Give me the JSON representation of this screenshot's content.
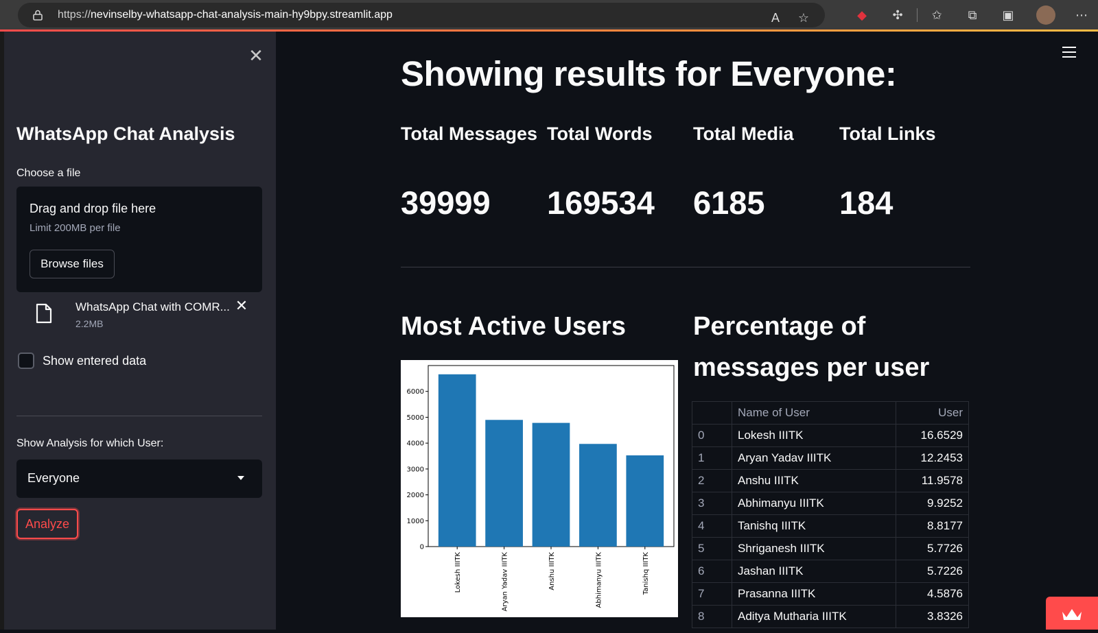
{
  "browser": {
    "url_prefix": "https://",
    "url_domain": "nevinselby-whatsapp-chat-analysis-main-hy9bpy.streamlit.app"
  },
  "sidebar": {
    "title": "WhatsApp Chat Analysis",
    "file_label": "Choose a file",
    "uploader": {
      "drag_text": "Drag and drop file here",
      "limit_text": "Limit 200MB per file",
      "browse_label": "Browse files"
    },
    "file": {
      "name": "WhatsApp Chat with COMR...",
      "size": "2.2MB"
    },
    "checkbox_label": "Show entered data",
    "user_label": "Show Analysis for which User:",
    "user_selected": "Everyone",
    "analyze_label": "Analyze"
  },
  "main": {
    "title": "Showing results for Everyone:",
    "stats": [
      {
        "label": "Total Messages",
        "value": "39999"
      },
      {
        "label": "Total Words",
        "value": "169534"
      },
      {
        "label": "Total Media",
        "value": "6185"
      },
      {
        "label": "Total Links",
        "value": "184"
      }
    ],
    "most_active_title": "Most Active Users",
    "percentage_title_line1": "Percentage of",
    "percentage_title_line2": "messages per user",
    "table": {
      "columns": [
        "",
        "Name of User",
        "User"
      ],
      "rows": [
        [
          "0",
          "Lokesh IIITK",
          "16.6529"
        ],
        [
          "1",
          "Aryan Yadav IIITK",
          "12.2453"
        ],
        [
          "2",
          "Anshu IIITK",
          "11.9578"
        ],
        [
          "3",
          "Abhimanyu IIITK",
          "9.9252"
        ],
        [
          "4",
          "Tanishq IIITK",
          "8.8177"
        ],
        [
          "5",
          "Shriganesh IIITK",
          "5.7726"
        ],
        [
          "6",
          "Jashan IIITK",
          "5.7226"
        ],
        [
          "7",
          "Prasanna IIITK",
          "4.5876"
        ],
        [
          "8",
          "Aditya Mutharia IIITK",
          "3.8326"
        ]
      ]
    }
  },
  "chart_data": {
    "type": "bar",
    "categories": [
      "Lokesh IIITK",
      "Aryan Yadav IIITK",
      "Anshu IIITK",
      "Abhimanyu IIITK",
      "Tanishq IIITK"
    ],
    "values": [
      6661,
      4898,
      4783,
      3970,
      3527
    ],
    "ylim": [
      0,
      7000
    ],
    "yticks": [
      0,
      1000,
      2000,
      3000,
      4000,
      5000,
      6000
    ],
    "bar_color": "#1f77b4",
    "title": "",
    "xlabel": "",
    "ylabel": ""
  },
  "colors": {
    "accent": "#ff4b4b",
    "background": "#0e1117",
    "sidebar": "#262730"
  }
}
